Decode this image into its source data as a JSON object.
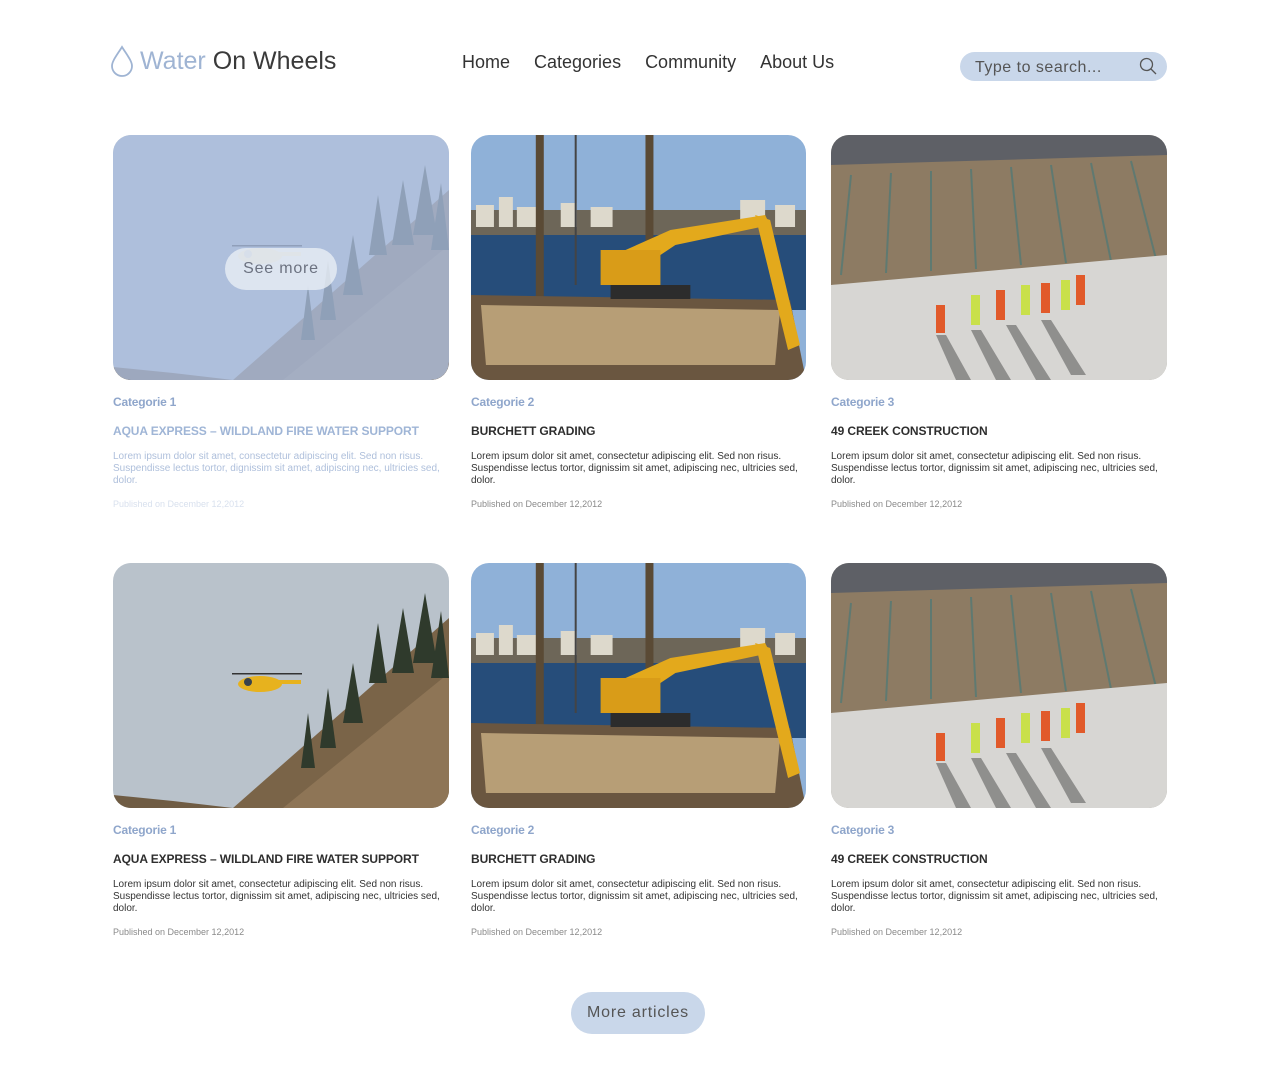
{
  "brand": {
    "part1": "Water",
    "part2": "On Wheels"
  },
  "nav": {
    "items": [
      "Home",
      "Categories",
      "Community",
      "About Us"
    ]
  },
  "search": {
    "placeholder": "Type to search..."
  },
  "cards": [
    {
      "category": "Categorie 1",
      "title": "AQUA EXPRESS – WILDLAND FIRE WATER SUPPORT",
      "description": "Lorem ipsum dolor sit amet, consectetur adipiscing elit. Sed non risus. Suspendisse lectus tortor, dignissim sit amet, adipiscing nec, ultricies sed, dolor.",
      "date": "Published on December 12,2012",
      "see_more": "See more"
    },
    {
      "category": "Categorie 2",
      "title": "BURCHETT GRADING",
      "description": "Lorem ipsum dolor sit amet, consectetur adipiscing elit. Sed non risus. Suspendisse lectus tortor, dignissim sit amet, adipiscing nec, ultricies sed, dolor.",
      "date": "Published on December 12,2012"
    },
    {
      "category": "Categorie 3",
      "title": "49 CREEK CONSTRUCTION",
      "description": "Lorem ipsum dolor sit amet, consectetur adipiscing elit. Sed non risus. Suspendisse lectus tortor, dignissim sit amet, adipiscing nec, ultricies sed, dolor.",
      "date": "Published on December 12,2012"
    },
    {
      "category": "Categorie 1",
      "title": "AQUA EXPRESS – WILDLAND FIRE WATER SUPPORT",
      "description": "Lorem ipsum dolor sit amet, consectetur adipiscing elit. Sed non risus. Suspendisse lectus tortor, dignissim sit amet, adipiscing nec, ultricies sed, dolor.",
      "date": "Published on December 12,2012"
    },
    {
      "category": "Categorie 2",
      "title": "BURCHETT GRADING",
      "description": "Lorem ipsum dolor sit amet, consectetur adipiscing elit. Sed non risus. Suspendisse lectus tortor, dignissim sit amet, adipiscing nec, ultricies sed, dolor.",
      "date": "Published on December 12,2012"
    },
    {
      "category": "Categorie 3",
      "title": "49 CREEK CONSTRUCTION",
      "description": "Lorem ipsum dolor sit amet, consectetur adipiscing elit. Sed non risus. Suspendisse lectus tortor, dignissim sit amet, adipiscing nec, ultricies sed, dolor.",
      "date": "Published on December 12,2012"
    }
  ],
  "more_articles": "More articles",
  "icons": {
    "logo": "water-drop-icon",
    "search": "search-icon"
  },
  "colors": {
    "accent": "#c9d7ea",
    "brand_light": "#9fb4d3",
    "category": "#8fa6cb"
  }
}
